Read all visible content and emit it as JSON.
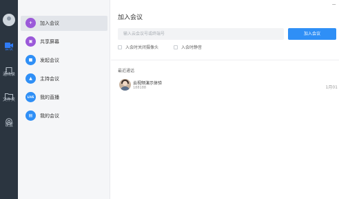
{
  "window": {
    "minimize_glyph": "−"
  },
  "rail": {
    "items": [
      {
        "label": "会议",
        "icon": "video-camera-icon",
        "active": true
      },
      {
        "label": "通讯录",
        "icon": "contacts-icon",
        "active": false
      },
      {
        "label": "文件夹",
        "icon": "folder-icon",
        "active": false
      },
      {
        "label": "设置",
        "icon": "settings-icon",
        "active": false
      }
    ]
  },
  "menu": {
    "items": [
      {
        "label": "加入会议",
        "icon": "plus-icon",
        "icon_text": "+",
        "color": "#9b59d9",
        "active": true
      },
      {
        "label": "共享屏幕",
        "icon": "screen-share-icon",
        "icon_text": "▣",
        "color": "#9b59d9",
        "active": false
      },
      {
        "label": "发起会议",
        "icon": "video-icon",
        "icon_text": "■",
        "color": "#2f8ff6",
        "active": false
      },
      {
        "label": "主持会议",
        "icon": "host-icon",
        "icon_text": "▲",
        "color": "#2f8ff6",
        "active": false
      },
      {
        "label": "我的直播",
        "icon": "live-icon",
        "icon_text": "LIVE",
        "color": "#2f8ff6",
        "active": false
      },
      {
        "label": "我的会议",
        "icon": "calendar-icon",
        "icon_text": "▤",
        "color": "#2f8ff6",
        "active": false
      }
    ]
  },
  "main": {
    "title": "加入会议",
    "search_placeholder": "输入云会议号或终端号",
    "join_button": "加入会议",
    "options": [
      {
        "label": "入会时关闭摄像头",
        "checked": false
      },
      {
        "label": "入会时静音",
        "checked": false
      }
    ],
    "recent_title": "最近通话",
    "recent": [
      {
        "name": "云视频演示体验",
        "id": "188188",
        "date": "1月01"
      }
    ]
  },
  "colors": {
    "accent": "#2f8ff6",
    "rail_bg": "#2b3540",
    "menu_bg": "#f5f6f8"
  }
}
